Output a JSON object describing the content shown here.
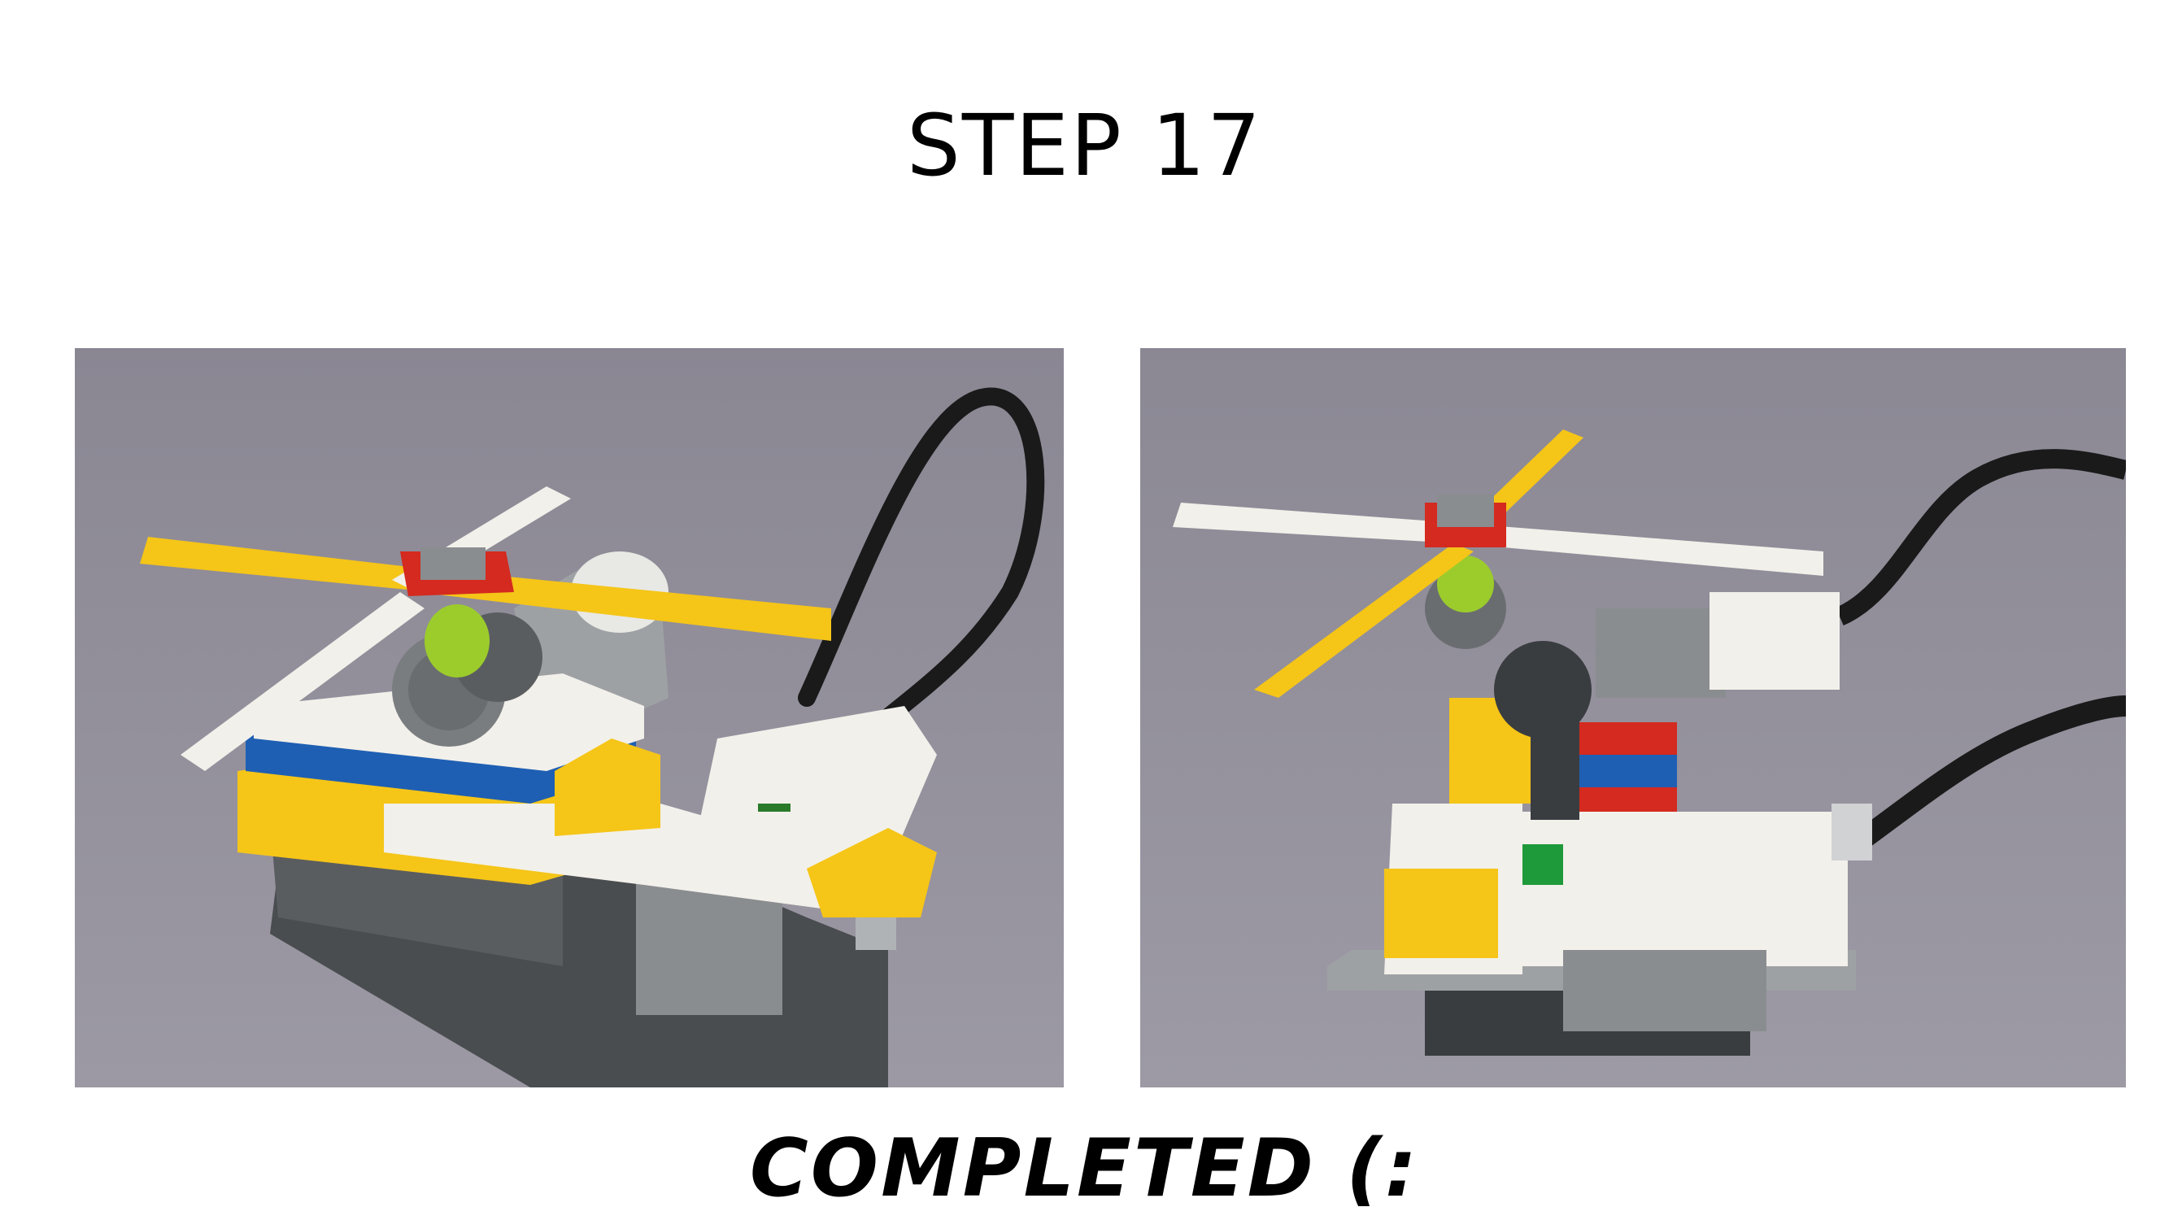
{
  "slide": {
    "title": "STEP 17",
    "caption": "COMPLETED (:"
  },
  "images": {
    "left": {
      "subject": "lego-helicopter-model-front-angle"
    },
    "right": {
      "subject": "lego-helicopter-model-side-view"
    }
  },
  "colors": {
    "background": "#ffffff",
    "text": "#000000",
    "photo_backdrop": "#8d8a96",
    "brick_yellow": "#f5c518",
    "brick_white": "#f2f0ea",
    "brick_red": "#d42a1f",
    "brick_blue": "#1e5fb3",
    "brick_grey": "#8a8d90",
    "brick_dark_grey": "#4a4d50",
    "axle_green": "#9ccc2c",
    "cable_black": "#1a1a1a"
  }
}
